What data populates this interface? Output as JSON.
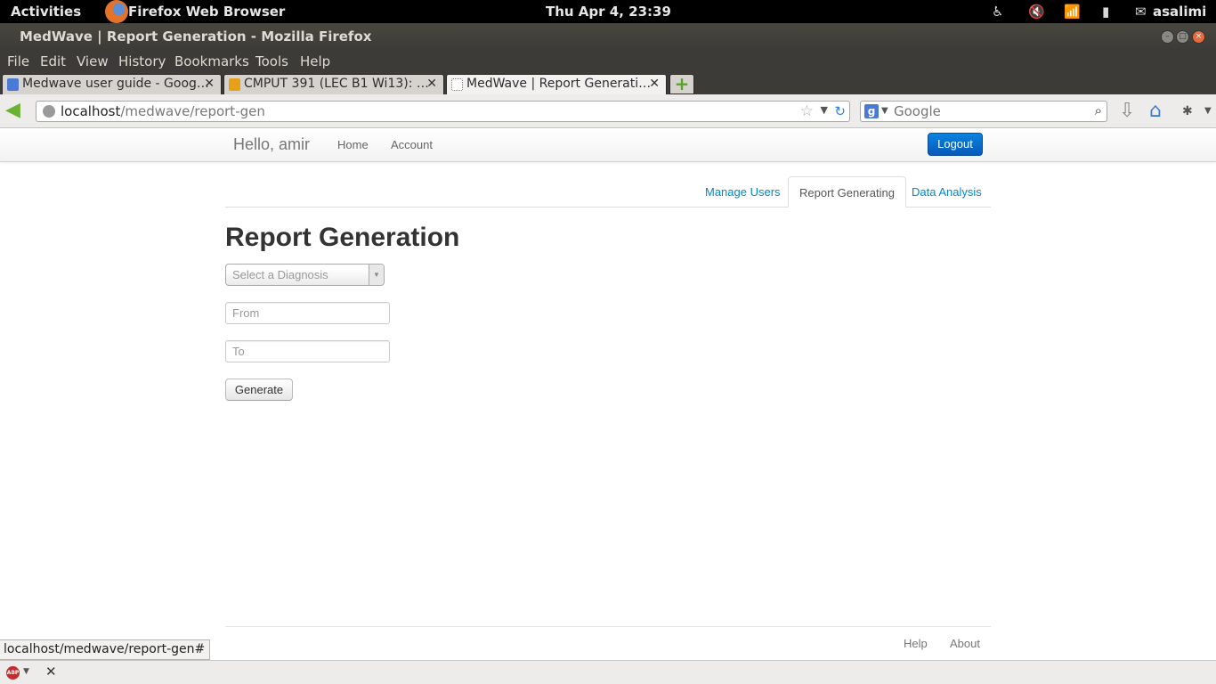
{
  "system": {
    "activities": "Activities",
    "app_name": "Firefox Web Browser",
    "clock": "Thu Apr  4, 23:39",
    "user": "asalimi"
  },
  "window": {
    "title": "MedWave | Report Generation - Mozilla Firefox"
  },
  "menu": [
    "File",
    "Edit",
    "View",
    "History",
    "Bookmarks",
    "Tools",
    "Help"
  ],
  "tabs": [
    {
      "label": "Medwave user guide - Goog…",
      "icon": "google-docs-icon",
      "active": false
    },
    {
      "label": "CMPUT 391 (LEC B1 Wi13): …",
      "icon": "moodle-icon",
      "active": false
    },
    {
      "label": "MedWave | Report Generati…",
      "icon": "blank-page-icon",
      "active": true
    }
  ],
  "nav": {
    "url_host": "localhost",
    "url_path": "/medwave/report-gen",
    "search_placeholder": "Google"
  },
  "app": {
    "greeting": "Hello, amir",
    "nav_links": [
      "Home",
      "Account"
    ],
    "logout_label": "Logout",
    "page_tabs": [
      {
        "label": "Manage Users",
        "active": false
      },
      {
        "label": "Report Generating",
        "active": true
      },
      {
        "label": "Data Analysis",
        "active": false
      }
    ],
    "heading": "Report Generation",
    "diagnosis_placeholder": "Select a Diagnosis",
    "from_placeholder": "From",
    "to_placeholder": "To",
    "generate_label": "Generate",
    "footer_links": [
      "Help",
      "About"
    ]
  },
  "status": {
    "link_preview": "localhost/medwave/report-gen#"
  },
  "colors": {
    "link": "#0088cc",
    "logout_button": "#0759b8",
    "chrome_dark": "#3c3b37"
  }
}
